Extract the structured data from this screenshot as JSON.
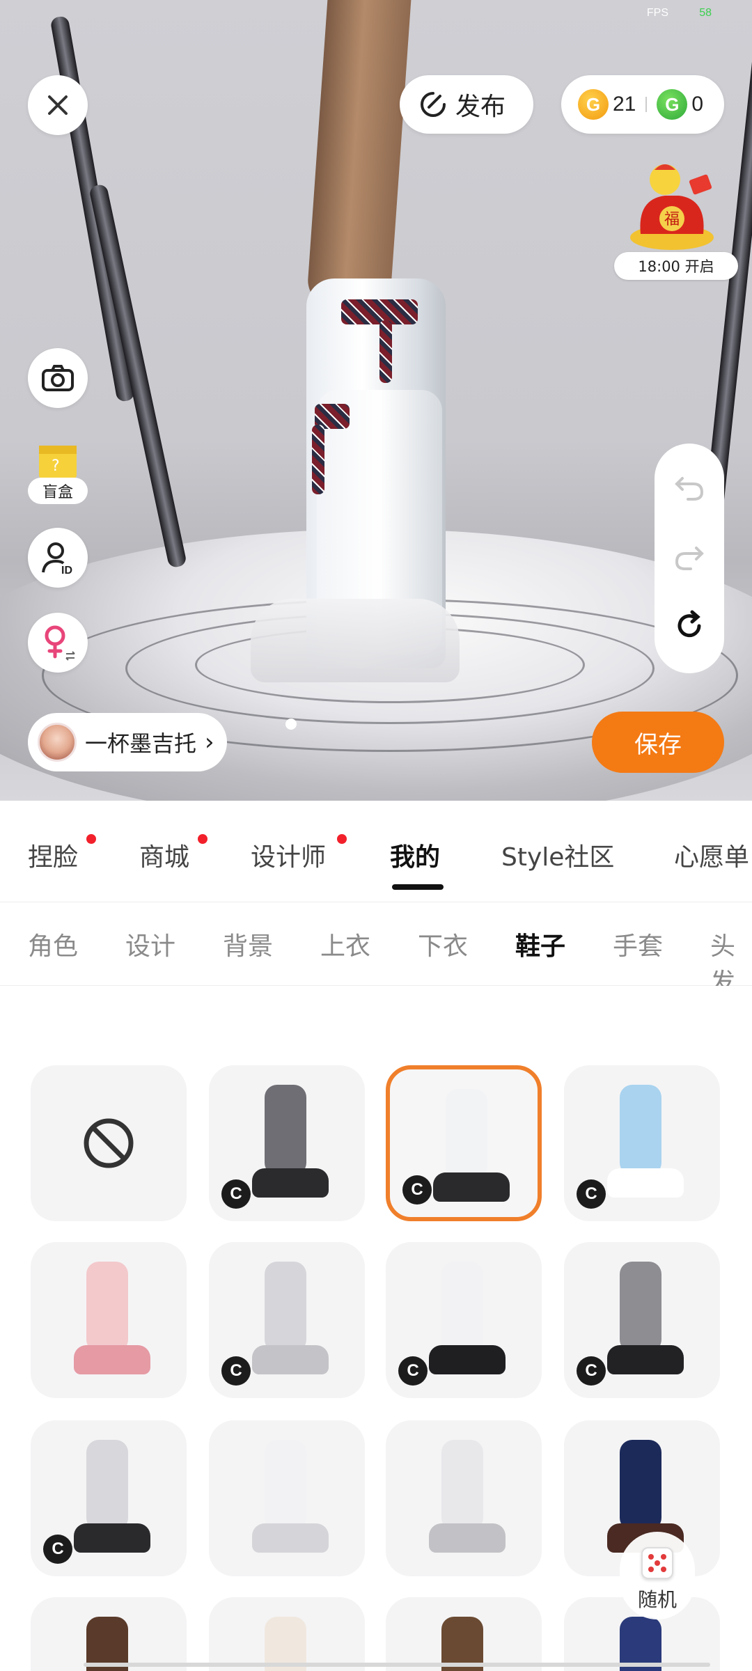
{
  "status": {
    "fps_label": "FPS",
    "fps_value": "58"
  },
  "top_bar": {
    "publish_label": "发布",
    "gold_coin_count": "21",
    "green_coin_count": "0",
    "gold_coin_glyph": "G",
    "green_coin_glyph": "G"
  },
  "fortune_event": {
    "time_label": "18:00 开启",
    "icon": "fortune-bag-icon"
  },
  "left_tools": {
    "blindbox_label": "盲盒"
  },
  "designer": {
    "name": "一杯墨吉托",
    "chevron": "›"
  },
  "save_label": "保存",
  "main_tabs": [
    {
      "label": "捏脸",
      "badge": true
    },
    {
      "label": "商城",
      "badge": true
    },
    {
      "label": "设计师",
      "badge": true
    },
    {
      "label": "我的",
      "active": true
    },
    {
      "label": "Style社区"
    },
    {
      "label": "心愿单"
    }
  ],
  "sub_tabs": [
    {
      "label": "角色"
    },
    {
      "label": "设计"
    },
    {
      "label": "背景"
    },
    {
      "label": "上衣"
    },
    {
      "label": "下衣"
    },
    {
      "label": "鞋子",
      "active": true
    },
    {
      "label": "手套"
    },
    {
      "label": "头发"
    }
  ],
  "items": [
    {
      "kind": "none",
      "icon": "no-item-icon"
    },
    {
      "kind": "item",
      "badge": "C",
      "colors": [
        "#6e6e74",
        "#2b2b2e"
      ]
    },
    {
      "kind": "item",
      "badge": "C",
      "selected": true,
      "colors": [
        "#f2f3f5",
        "#2a2a2c"
      ]
    },
    {
      "kind": "item",
      "badge": "C",
      "colors": [
        "#a9d3ef",
        "#ffffff"
      ]
    },
    {
      "kind": "item",
      "colors": [
        "#f3c9cc",
        "#e59aa4"
      ]
    },
    {
      "kind": "item",
      "badge": "C",
      "colors": [
        "#d6d6da",
        "#c4c4c8"
      ]
    },
    {
      "kind": "item",
      "badge": "C",
      "colors": [
        "#f2f2f4",
        "#1f1f22"
      ]
    },
    {
      "kind": "item",
      "badge": "C",
      "colors": [
        "#8d8d92",
        "#222225"
      ]
    },
    {
      "kind": "item",
      "badge": "C",
      "colors": [
        "#d7d7dc",
        "#2a2a2d"
      ]
    },
    {
      "kind": "item",
      "colors": [
        "#f2f2f4",
        "#d5d5d9"
      ]
    },
    {
      "kind": "item",
      "colors": [
        "#e8e8eb",
        "#c2c2c6"
      ]
    },
    {
      "kind": "item",
      "colors": [
        "#1c2a5a",
        "#4a2a22"
      ]
    },
    {
      "kind": "item",
      "colors": [
        "#5a3a2a",
        "#3a2a22"
      ]
    },
    {
      "kind": "item",
      "colors": [
        "#f0e8df",
        "#d8cfc4"
      ]
    },
    {
      "kind": "item",
      "colors": [
        "#6a4a32",
        "#4a3428"
      ]
    },
    {
      "kind": "item",
      "colors": [
        "#2a3a7a",
        "#1a2a5a"
      ]
    }
  ],
  "random": {
    "label": "随机"
  },
  "colors": {
    "accent": "#f47a14",
    "selected_border": "#f07f2b",
    "badge_red": "#f2202b"
  }
}
